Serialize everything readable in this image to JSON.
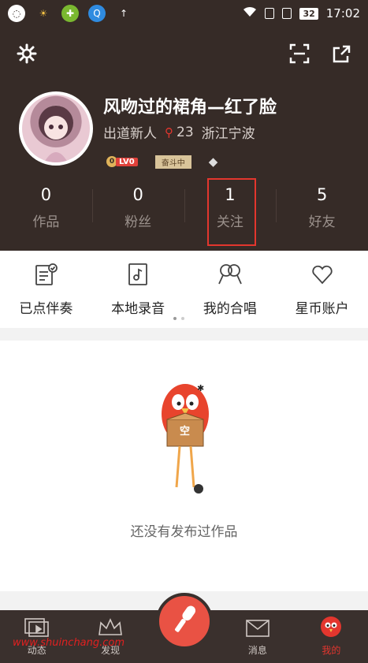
{
  "status_bar": {
    "battery": "32",
    "time": "17:02"
  },
  "profile": {
    "username": "风吻过的裙角—红了脸",
    "title": "出道新人",
    "count": "23",
    "location": "浙江宁波",
    "level_badge": "LV0",
    "level_coin": "0",
    "rank_badge": "奋斗中"
  },
  "stats": [
    {
      "value": "0",
      "label": "作品"
    },
    {
      "value": "0",
      "label": "粉丝"
    },
    {
      "value": "1",
      "label": "关注"
    },
    {
      "value": "5",
      "label": "好友"
    }
  ],
  "menu": [
    {
      "label": "已点伴奏",
      "icon": "playlist-check-icon"
    },
    {
      "label": "本地录音",
      "icon": "music-note-icon"
    },
    {
      "label": "我的合唱",
      "icon": "duet-mic-icon"
    },
    {
      "label": "星币账户",
      "icon": "heart-icon"
    }
  ],
  "empty_state": {
    "mascot_text": "空",
    "message": "还没有发布过作品"
  },
  "tabs": [
    {
      "label": "动态",
      "icon": "video-feed-icon"
    },
    {
      "label": "发现",
      "icon": "crown-icon"
    },
    {
      "label": "消息",
      "icon": "envelope-icon"
    },
    {
      "label": "我的",
      "icon": "profile-bird-icon"
    }
  ],
  "watermark": "www.shuinchang.com"
}
